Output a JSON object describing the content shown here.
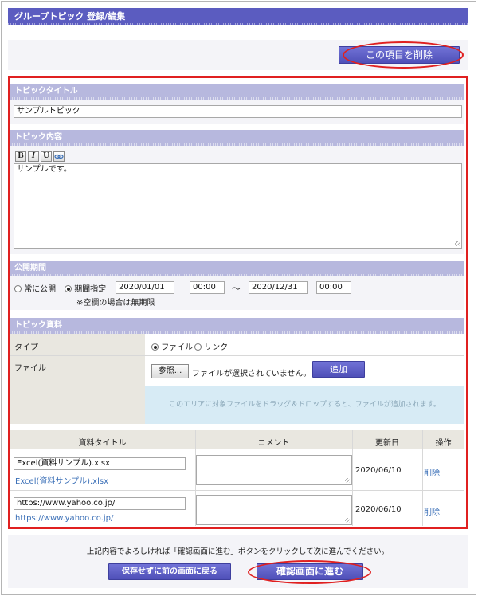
{
  "page_title": "グループトピック 登録/編集",
  "delete_button": "この項目を削除",
  "topic_title": {
    "heading": "トピックタイトル",
    "value": "サンプルトピック"
  },
  "topic_content": {
    "heading": "トピック内容",
    "toolbar": {
      "bold": "B",
      "italic": "I",
      "underline": "U"
    },
    "body": "サンプルです。"
  },
  "publish_period": {
    "heading": "公開期間",
    "always_label": "常に公開",
    "specified_label": "期間指定",
    "start_date": "2020/01/01",
    "start_time": "00:00",
    "separator": "〜",
    "end_date": "2020/12/31",
    "end_time": "00:00",
    "note": "※空欄の場合は無期限"
  },
  "topic_material": {
    "heading": "トピック資料",
    "type_label": "タイプ",
    "type_file": "ファイル",
    "type_link": "リンク",
    "file_label": "ファイル",
    "browse_button": "参照...",
    "no_file_text": "ファイルが選択されていません。",
    "add_button": "追加",
    "drop_area_text": "このエリアに対象ファイルをドラッグ＆ドロップすると、ファイルが追加されます。"
  },
  "materials_table": {
    "columns": [
      "資料タイトル",
      "コメント",
      "更新日",
      "操作"
    ],
    "rows": [
      {
        "title": "Excel(資料サンプル).xlsx",
        "link": "Excel(資料サンプル).xlsx",
        "comment": "",
        "updated": "2020/06/10",
        "action": "削除"
      },
      {
        "title": "https://www.yahoo.co.jp/",
        "link": "https://www.yahoo.co.jp/",
        "comment": "",
        "updated": "2020/06/10",
        "action": "削除"
      }
    ]
  },
  "footer": {
    "instruction": "上記内容でよろしければ「確認画面に進む」ボタンをクリックして次に進んでください。",
    "back_button": "保存せずに前の画面に戻る",
    "confirm_button": "確認画面に進む"
  },
  "colors": {
    "header": "#5b5cc0",
    "section": "#b7b8de",
    "highlight": "#e02020",
    "link": "#3a6fb7"
  }
}
